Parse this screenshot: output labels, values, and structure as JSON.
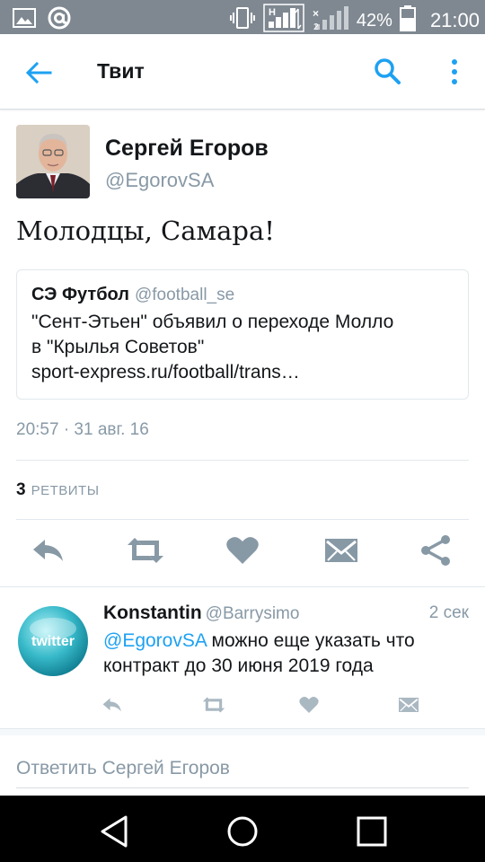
{
  "status_bar": {
    "battery": "42%",
    "time": "21:00",
    "icons": [
      "image-icon",
      "at-icon",
      "vibrate-icon",
      "signal-h-icon",
      "signal-2-icon",
      "battery-icon"
    ]
  },
  "app_bar": {
    "title": "Твит",
    "back_icon": "arrow-back-icon",
    "search_icon": "search-icon",
    "more_icon": "more-vertical-icon"
  },
  "tweet": {
    "author_name": "Сергей Егоров",
    "author_handle": "@EgorovSA",
    "text": "Молодцы, Самара!",
    "quoted": {
      "name": "СЭ Футбол",
      "handle": "@football_se",
      "line1": "\"Сент-Этьен\" объявил о переходе Молло",
      "line2": "в \"Крылья Советов\"",
      "line3": "sport-express.ru/football/trans…"
    },
    "timestamp": "20:57 · 31 авг. 16",
    "retweet_count": "3",
    "retweet_label": "РЕТВИТЫ",
    "actions": [
      "reply-icon",
      "retweet-icon",
      "like-icon",
      "message-icon",
      "share-icon"
    ]
  },
  "reply": {
    "name": "Konstantin",
    "handle": "@Barrysimo",
    "time": "2 сек",
    "mention": "@EgorovSA",
    "text_line1_rest": " можно еще указать что",
    "text_line2": "контракт до 30 июня 2019 года",
    "avatar_label": "twitter",
    "actions": [
      "reply-icon",
      "retweet-icon",
      "like-icon",
      "message-icon"
    ]
  },
  "reply_input": {
    "placeholder": "Ответить Сергей Егоров"
  },
  "colors": {
    "accent": "#1da1f2",
    "action_icon": "#8899a6",
    "status_bar": "#7f8891"
  }
}
